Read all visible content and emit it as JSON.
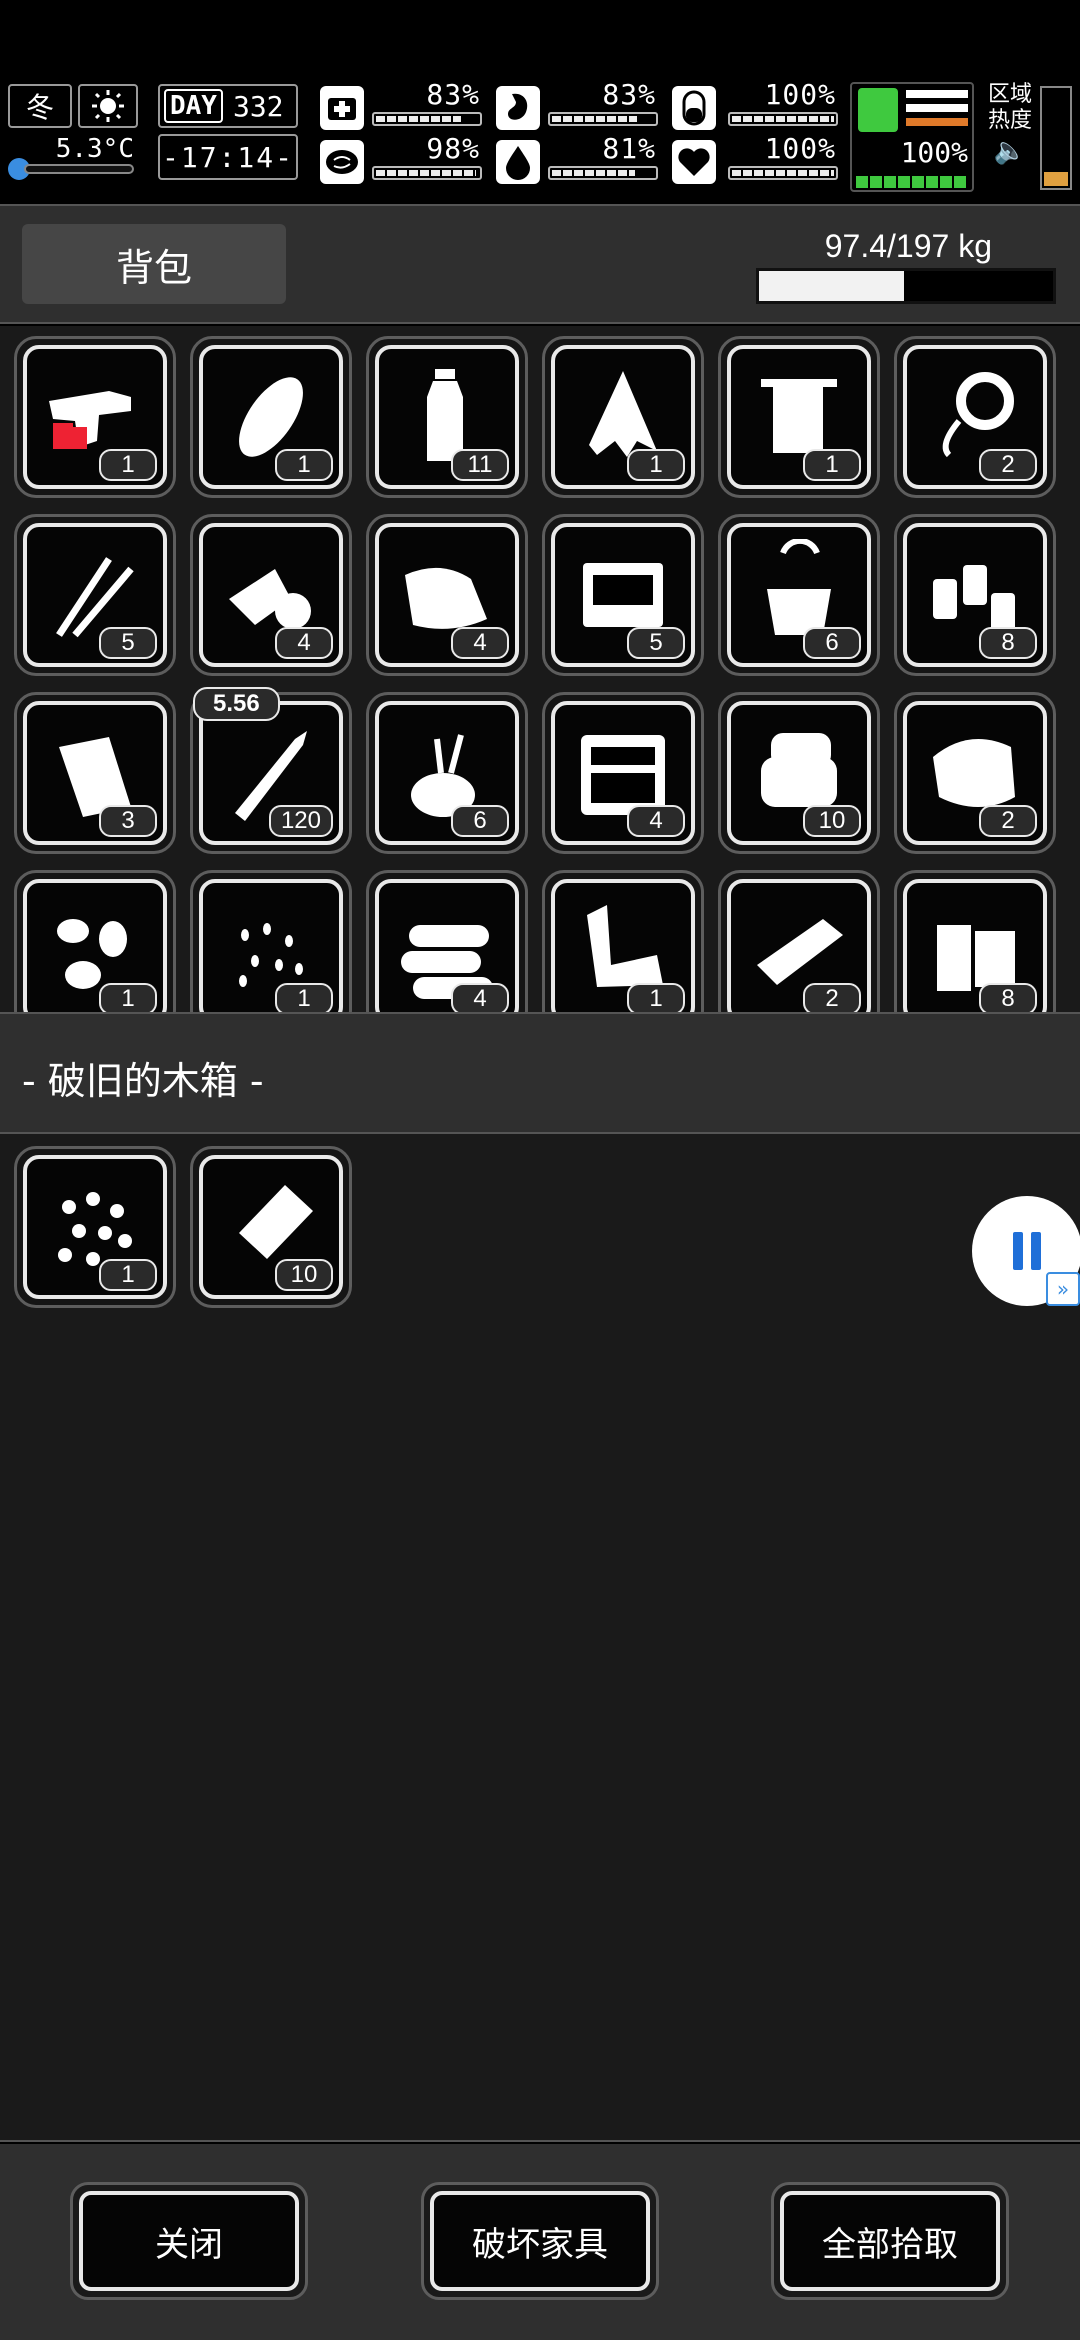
{
  "status": {
    "season_label": "冬",
    "temperature": "5.3°C",
    "day_label": "DAY",
    "day_number": "332",
    "clock": "-17:14-",
    "stats": [
      {
        "icon": "medkit-icon",
        "value": "83%",
        "fraction": 0.83
      },
      {
        "icon": "stomach-icon",
        "value": "83%",
        "fraction": 0.83
      },
      {
        "icon": "pill-icon",
        "value": "100%",
        "fraction": 1.0
      },
      {
        "icon": "brain-icon",
        "value": "98%",
        "fraction": 0.98
      },
      {
        "icon": "water-drop-icon",
        "value": "81%",
        "fraction": 0.81
      },
      {
        "icon": "heart-icon",
        "value": "100%",
        "fraction": 1.0
      }
    ],
    "stamina_value": "100%",
    "stamina_fraction": 1.0,
    "zone_heat_label_1": "区域",
    "zone_heat_label_2": "热度",
    "accent_green": "#3fc93f",
    "accent_orange": "#e07a2a"
  },
  "backpack": {
    "tab_label": "背包",
    "weight_text": "97.4/197 kg",
    "weight_fraction": 0.494,
    "items": [
      {
        "icon": "flare-gun-icon",
        "qty": "1"
      },
      {
        "icon": "bread-icon",
        "qty": "1"
      },
      {
        "icon": "water-bottle-icon",
        "qty": "11"
      },
      {
        "icon": "torn-cloth-icon",
        "qty": "1"
      },
      {
        "icon": "towel-icon",
        "qty": "1"
      },
      {
        "icon": "rope-icon",
        "qty": "2"
      },
      {
        "icon": "lockpick-icon",
        "qty": "5"
      },
      {
        "icon": "bandage-roll-icon",
        "qty": "4"
      },
      {
        "icon": "cloth-roll-icon",
        "qty": "4"
      },
      {
        "icon": "toolbox-open-icon",
        "qty": "5"
      },
      {
        "icon": "tool-bucket-icon",
        "qty": "6"
      },
      {
        "icon": "spray-cans-icon",
        "qty": "8"
      },
      {
        "icon": "paper-scroll-icon",
        "qty": "3"
      },
      {
        "icon": "bullet-icon",
        "qty": "120",
        "tag": "5.56"
      },
      {
        "icon": "tool-bag-icon",
        "qty": "6"
      },
      {
        "icon": "toolkit-case-icon",
        "qty": "4"
      },
      {
        "icon": "folded-cloth-icon",
        "qty": "10"
      },
      {
        "icon": "meat-icon",
        "qty": "2"
      },
      {
        "icon": "potatoes-icon",
        "qty": "1"
      },
      {
        "icon": "seeds-icon",
        "qty": "1"
      },
      {
        "icon": "logs-icon",
        "qty": "4"
      },
      {
        "icon": "scrap-metal-icon",
        "qty": "1"
      },
      {
        "icon": "board-icon",
        "qty": "2"
      },
      {
        "icon": "planks-icon",
        "qty": "8"
      }
    ]
  },
  "container": {
    "title": "- 破旧的木箱 -",
    "items": [
      {
        "icon": "beads-icon",
        "qty": "1"
      },
      {
        "icon": "plastic-bag-icon",
        "qty": "10"
      }
    ]
  },
  "footer": {
    "close_label": "关闭",
    "destroy_label": "破坏家具",
    "take_all_label": "全部拾取"
  }
}
